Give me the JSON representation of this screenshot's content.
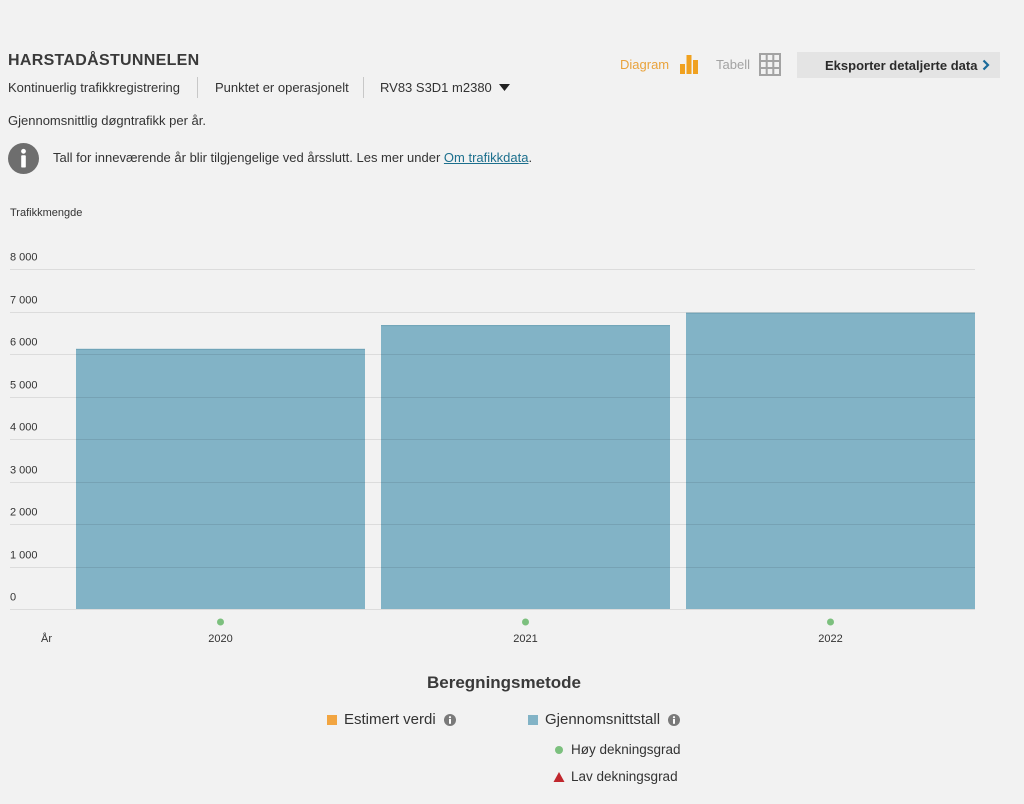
{
  "header": {
    "title": "HARSTADÅSTUNNELEN",
    "meta": [
      "Kontinuerlig trafikkregistrering",
      "Punktet er operasjonelt"
    ],
    "road_selector": {
      "value": "RV83 S3D1 m2380",
      "icon": "caret-down-icon"
    },
    "view_toggle": {
      "diagram": {
        "label": "Diagram",
        "icon": "bar-chart-icon",
        "active": true
      },
      "table": {
        "label": "Tabell",
        "icon": "grid-icon",
        "active": false
      }
    },
    "export_button": {
      "label": "Eksporter detaljerte data",
      "icon": "chevron-right-icon"
    }
  },
  "description": "Gjennomsnittlig døgntrafikk per år.",
  "notice": {
    "icon": "info-icon",
    "text": "Tall for inneværende år blir tilgjengelige ved årsslutt. Les mer under ",
    "link": "Om trafikkdata",
    "end": "."
  },
  "colors": {
    "background": "#f2f2f2",
    "text": "#333333",
    "active_toggle": "#e9a33c",
    "inactive_toggle": "#a3a3a3",
    "link": "#1c6f8d",
    "export_button_bg": "#e4e4e4",
    "export_chevron": "#1a6a9a",
    "info_icon": "#6e6e6e",
    "gridline": "#dcdcdc"
  },
  "chart_data": {
    "type": "bar",
    "ylabel": "Trafikkmengde",
    "xlabel": "År",
    "categories": [
      "2020",
      "2021",
      "2022"
    ],
    "series": [
      {
        "name": "Estimert verdi",
        "color": "#f2a541",
        "values": [
          null,
          null,
          null
        ]
      },
      {
        "name": "Gjennomsnittstall",
        "color": "#82b3c6",
        "values": [
          6120,
          6680,
          6970
        ]
      }
    ],
    "coverage": {
      "levels": [
        {
          "label": "Høy dekningsgrad",
          "color": "#7cc07e",
          "marker_icon": "dot-icon"
        },
        {
          "label": "Lav dekningsgrad",
          "color": "#c0272d",
          "marker_icon": "triangle-icon"
        }
      ],
      "per_category": [
        0,
        0,
        0
      ]
    },
    "ylim": [
      0,
      8000
    ],
    "yticks": [
      0,
      1000,
      2000,
      3000,
      4000,
      5000,
      6000,
      7000,
      8000
    ],
    "ytick_labels": [
      "0",
      "1 000",
      "2 000",
      "3 000",
      "4 000",
      "5 000",
      "6 000",
      "7 000",
      "8 000"
    ],
    "grid": true,
    "legend": {
      "title": "Beregningsmetode",
      "position": "bottom-center"
    }
  }
}
